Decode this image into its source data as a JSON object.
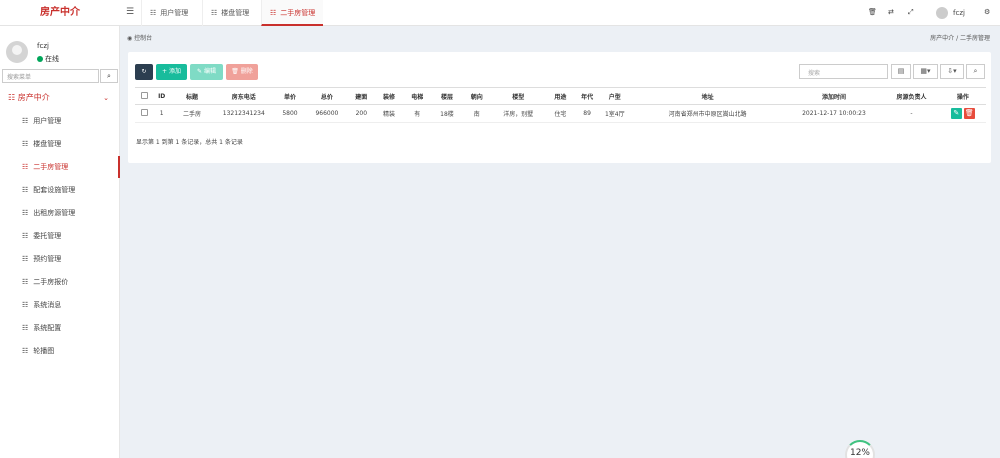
{
  "app": {
    "logo": "房产中介"
  },
  "topbar": {
    "tabs": [
      {
        "label": "用户管理"
      },
      {
        "label": "楼盘管理"
      },
      {
        "label": "二手房管理"
      }
    ],
    "user": "fczj"
  },
  "sidebar": {
    "user": {
      "name": "fczj",
      "status": "在线"
    },
    "search_placeholder": "搜索菜单",
    "group": "房产中介",
    "items": [
      {
        "label": "用户管理"
      },
      {
        "label": "楼盘管理"
      },
      {
        "label": "二手房管理"
      },
      {
        "label": "配套设施管理"
      },
      {
        "label": "出租房源管理"
      },
      {
        "label": "委托管理"
      },
      {
        "label": "预约管理"
      },
      {
        "label": "二手房报价"
      },
      {
        "label": "系统消息"
      },
      {
        "label": "系统配置"
      },
      {
        "label": "轮播图"
      }
    ]
  },
  "breadcrumb": {
    "left": "控制台",
    "right": "房产中介 / 二手房管理"
  },
  "toolbar": {
    "refresh": "↻",
    "add": "+ 添加",
    "edit": "✎ 编辑",
    "delete": "🗑 删除",
    "search_placeholder": "搜索"
  },
  "table": {
    "columns": [
      "ID",
      "标题",
      "房东电话",
      "单价",
      "总价",
      "建面",
      "装修",
      "电梯",
      "楼层",
      "朝向",
      "楼型",
      "用途",
      "年代",
      "户型",
      "地址",
      "添加时间",
      "房源负责人",
      "操作"
    ],
    "rows": [
      [
        "1",
        "二手房",
        "13212341234",
        "5800",
        "966000",
        "200",
        "精装",
        "有",
        "18楼",
        "南",
        "洋房，别墅",
        "住宅",
        "89",
        "1室4厅",
        "河南省郑州市中原区嵩山北路",
        "2021-12-17 10:00:23",
        "-"
      ]
    ]
  },
  "pager": "显示第 1 到第 1 条记录，总共 1 条记录",
  "progress": "12%",
  "colors": {
    "brand": "#c9302c",
    "add": "#18bc9c",
    "delete": "#e74c3c",
    "refresh": "#2c3e50"
  }
}
